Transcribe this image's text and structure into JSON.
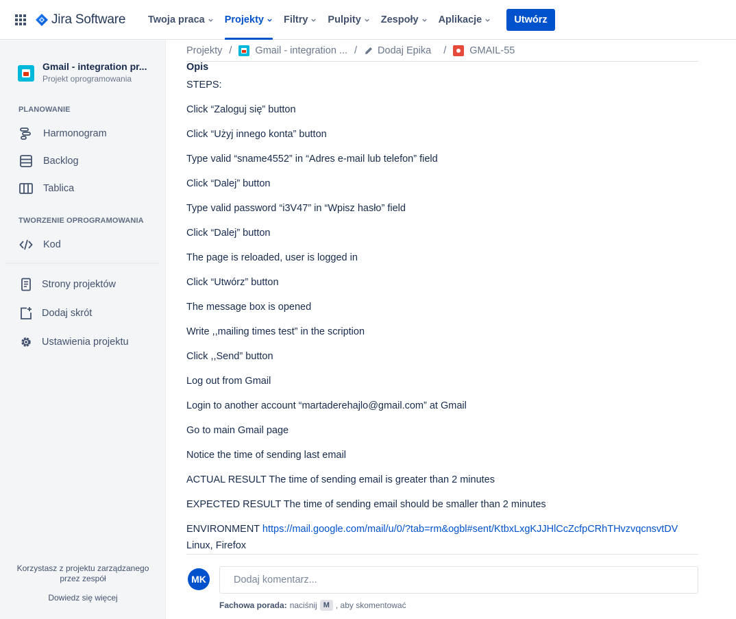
{
  "app": {
    "name": "Jira Software"
  },
  "nav": {
    "items": [
      {
        "label": "Twoja praca"
      },
      {
        "label": "Projekty"
      },
      {
        "label": "Filtry"
      },
      {
        "label": "Pulpity"
      },
      {
        "label": "Zespoły"
      },
      {
        "label": "Aplikacje"
      }
    ],
    "active": "Projekty",
    "create_label": "Utwórz"
  },
  "sidebar": {
    "project_name": "Gmail - integration pr...",
    "project_type": "Projekt oprogramowania",
    "section_planning": "PLANOWANIE",
    "planning_items": [
      {
        "label": "Harmonogram",
        "icon": "timeline-icon"
      },
      {
        "label": "Backlog",
        "icon": "backlog-icon"
      },
      {
        "label": "Tablica",
        "icon": "board-icon"
      }
    ],
    "section_dev": "TWORZENIE OPROGRAMOWANIA",
    "dev_items": [
      {
        "label": "Kod",
        "icon": "code-icon"
      }
    ],
    "other_items": [
      {
        "label": "Strony projektów",
        "icon": "pages-icon"
      },
      {
        "label": "Dodaj skrót",
        "icon": "add-shortcut-icon"
      },
      {
        "label": "Ustawienia projektu",
        "icon": "gear-icon"
      }
    ],
    "footer_text_1": "Korzystasz z projektu zarządzanego",
    "footer_text_2": "przez zespół",
    "footer_link": "Dowiedz się więcej"
  },
  "breadcrumb": {
    "items": [
      "Projekty",
      "Gmail - integration ...",
      "Dodaj Epika",
      "GMAIL-55"
    ]
  },
  "description": {
    "label": "Opis",
    "lines": [
      "STEPS:",
      "Click “Zaloguj się” button",
      "Click “Użyj innego konta” button",
      "Type valid “sname4552” in “Adres e-mail lub telefon” field",
      "Click “Dalej” button",
      "Type valid password “i3V47” in “Wpisz hasło” field",
      "Click “Dalej” button",
      "The page is reloaded, user is logged in",
      "Click “Utwórz” button",
      "The message box is opened",
      "Write ,,mailing times test” in the scription",
      "Click ,,Send” button",
      "Log out from Gmail",
      "Login to another account “martaderehajlo@gmail.com” at Gmail",
      "Go to main Gmail page",
      "Notice the time of sending last  email",
      "ACTUAL RESULT The time of sending email is greater than 2 minutes",
      "EXPECTED RESULT  The time of sending email should be smaller than 2 minutes"
    ],
    "env_label": "ENVIRONMENT ",
    "env_link": "https://mail.google.com/mail/u/0/?tab=rm&ogbl#sent/KtbxLxgKJJHlCcZcfpCRhTHvzvqcnsvtDV",
    "env_line2": "Linux, Firefox"
  },
  "comment": {
    "avatar_initials": "MK",
    "placeholder": "Dodaj komentarz...",
    "tip_label": "Fachowa porada:",
    "tip_pre": "naciśnij",
    "tip_key": "M",
    "tip_post": ", aby skomentować"
  },
  "colors": {
    "brand": "#0052cc",
    "sidebar_bg": "#f4f5f7",
    "project_icon": "#00b8d9",
    "bug_icon": "#e5493a"
  }
}
